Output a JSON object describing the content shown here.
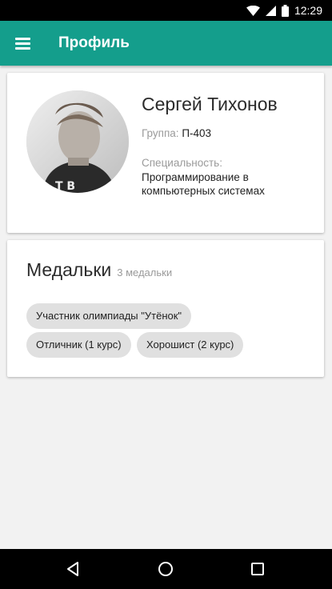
{
  "status_bar": {
    "time": "12:29",
    "icons": [
      "wifi-icon",
      "signal-icon",
      "battery-icon"
    ]
  },
  "app_bar": {
    "title": "Профиль",
    "menu_icon": "menu-icon",
    "color": "#149e8c"
  },
  "profile": {
    "name": "Сергей Тихонов",
    "group_label": "Группа:",
    "group_value": "П-403",
    "specialty_label": "Специальность:",
    "specialty_value": "Программирование в компьютерных системах"
  },
  "medals": {
    "title": "Медальки",
    "count_text": "3 медальки",
    "items": [
      {
        "label": "Участник олимпиады \"Утёнок\""
      },
      {
        "label": "Отличник (1 курс)"
      },
      {
        "label": "Хорошист (2 курс)"
      }
    ]
  },
  "nav_bar": {
    "buttons": [
      "back-icon",
      "home-icon",
      "recents-icon"
    ]
  }
}
